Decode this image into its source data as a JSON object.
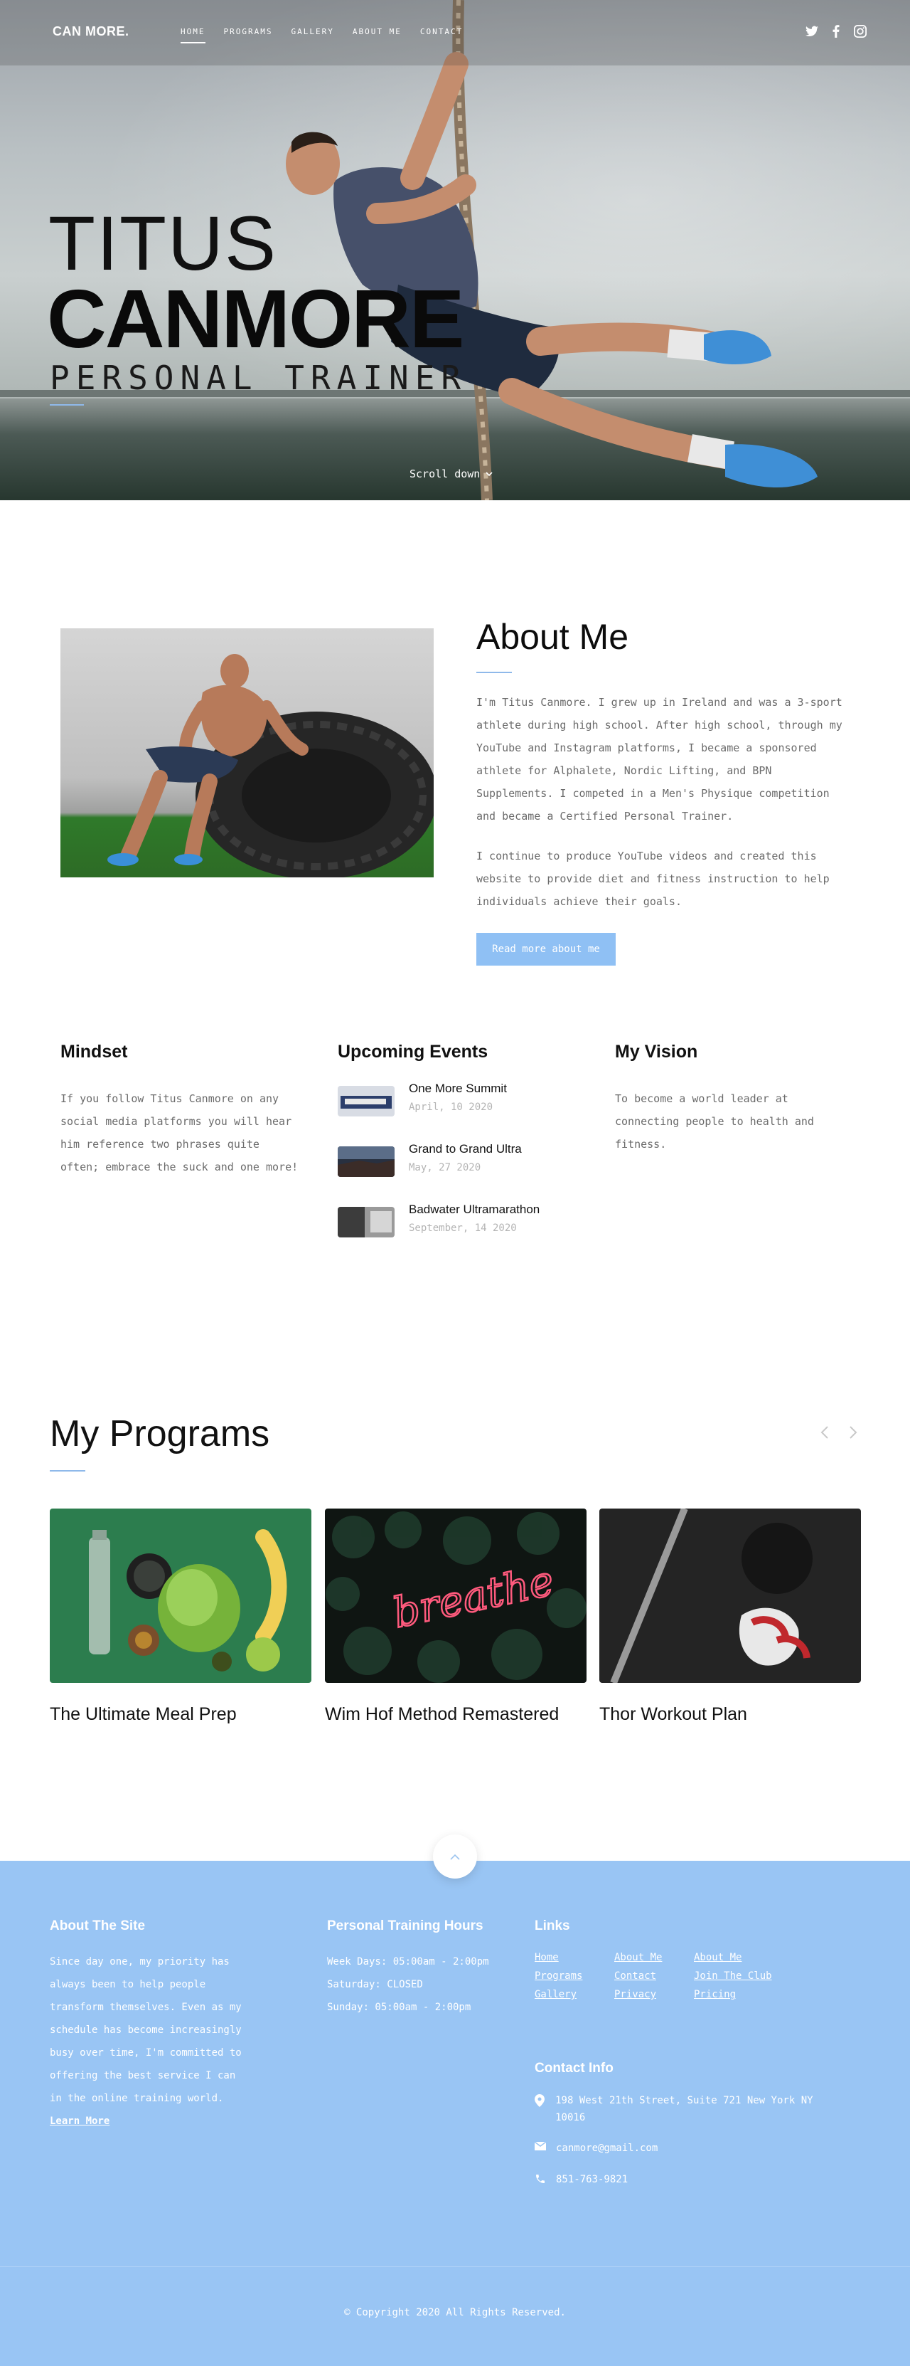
{
  "nav": {
    "logo": "CAN MORE.",
    "items": [
      "HOME",
      "PROGRAMS",
      "GALLERY",
      "ABOUT ME",
      "CONTACT"
    ],
    "social_icons": [
      "twitter-icon",
      "facebook-icon",
      "instagram-icon"
    ]
  },
  "hero": {
    "first_name": "TITUS",
    "last_name": "CANMORE",
    "subtitle": "PERSONAL TRAINER",
    "scroll_label": "Scroll down"
  },
  "about": {
    "title": "About Me",
    "paragraph1": "I'm Titus Canmore. I grew up in Ireland and was a 3-sport athlete during high school. After high school, through my YouTube and Instagram platforms, I became a sponsored athlete for Alphalete, Nordic Lifting, and BPN Supplements. I competed in a Men's Physique competition and became a Certified Personal Trainer.",
    "paragraph2": "I continue to produce YouTube videos and created this website to provide diet and fitness instruction to help individuals achieve their goals.",
    "button": "Read more about me"
  },
  "mindset": {
    "title": "Mindset",
    "text": "If you follow Titus Canmore on any social media platforms you will hear him reference two phrases quite often; embrace the suck and one more!"
  },
  "events": {
    "title": "Upcoming Events",
    "items": [
      {
        "title": "One More Summit",
        "date": "April, 10 2020"
      },
      {
        "title": "Grand to Grand Ultra",
        "date": "May, 27 2020"
      },
      {
        "title": "Badwater Ultramarathon",
        "date": "September, 14 2020"
      }
    ]
  },
  "vision": {
    "title": "My Vision",
    "text": "To become a world leader at connecting people to health and fitness."
  },
  "programs": {
    "title": "My Programs",
    "cards": [
      {
        "title": "The Ultimate Meal Prep"
      },
      {
        "title": "Wim Hof Method Remastered"
      },
      {
        "title": "Thor Workout Plan"
      }
    ],
    "neon_text": "breathe"
  },
  "footer": {
    "about_title": "About The Site",
    "about_text": "Since day one, my priority has always been to help people transform themselves. Even as my schedule has become increasingly busy over time, I'm committed to offering the best service I can in the online training world.",
    "about_link": "Learn More",
    "hours_title": "Personal Training Hours",
    "hours": [
      "Week Days: 05:00am - 2:00pm",
      "Saturday: CLOSED",
      "Sunday: 05:00am - 2:00pm"
    ],
    "links_title": "Links",
    "links": [
      "Home",
      "About Me",
      "About Me",
      "Programs",
      "Contact",
      "Join The Club",
      "Gallery",
      "Privacy",
      "Pricing"
    ],
    "contact_title": "Contact Info",
    "address": "198 West 21th Street, Suite 721 New York NY 10016",
    "email": "canmore@gmail.com",
    "phone": "851-763-9821",
    "copyright": "© Copyright 2020 All Rights Reserved."
  },
  "colors": {
    "accent": "#8fc0f4",
    "footer_bg": "#99c5f4",
    "text_muted": "#6b6b6b"
  }
}
